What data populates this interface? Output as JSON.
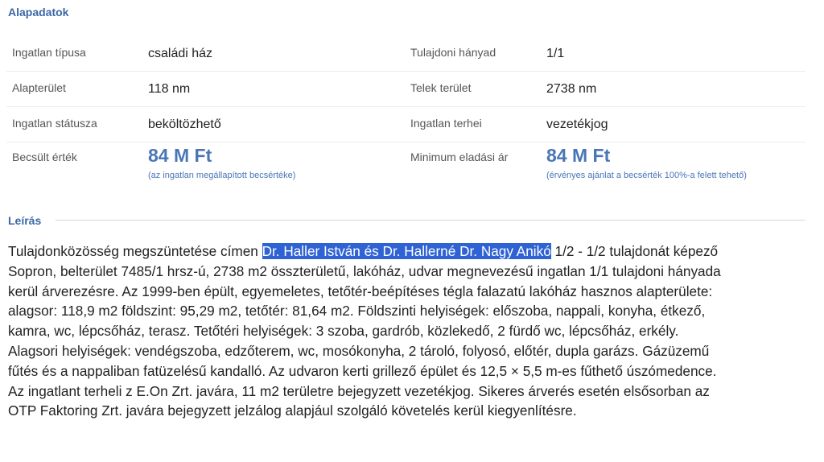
{
  "basic_data": {
    "title": "Alapadatok",
    "rows": [
      {
        "left": {
          "label": "Ingatlan típusa",
          "value": "családi ház"
        },
        "right": {
          "label": "Tulajdoni hányad",
          "value": "1/1"
        }
      },
      {
        "left": {
          "label": "Alapterület",
          "value": "118 nm"
        },
        "right": {
          "label": "Telek terület",
          "value": "2738 nm"
        }
      },
      {
        "left": {
          "label": "Ingatlan státusza",
          "value": "beköltözhető"
        },
        "right": {
          "label": "Ingatlan terhei",
          "value": "vezetékjog"
        }
      },
      {
        "left": {
          "label": "Becsült érték",
          "value": "84 M Ft",
          "note": "(az ingatlan megállapított becsértéke)"
        },
        "right": {
          "label": "Minimum eladási ár",
          "value": "84 M Ft",
          "note": "(érvényes ajánlat a becsérték 100%-a felett tehető)"
        }
      }
    ]
  },
  "description": {
    "title": "Leírás",
    "line1_before": "Tulajdonközösség megszüntetése címen ",
    "line1_highlight": "Dr. Haller István és Dr. Hallerné Dr. Nagy Anikó",
    "line1_after": " 1/2 - 1/2 tulajdonát képező",
    "lines": [
      "Sopron, belterület 7485/1 hrsz-ú, 2738 m2 összterületű, lakóház, udvar megnevezésű ingatlan 1/1 tulajdoni hányada",
      "kerül árverezésre. Az 1999-ben épült, egyemeletes, tetőtér-beépítéses tégla falazatú lakóház hasznos alapterülete:",
      "alagsor: 118,9 m2 földszint: 95,29 m2, tetőtér: 81,64 m2. Földszinti helyiségek: előszoba, nappali, konyha, étkező,",
      "kamra, wc, lépcsőház, terasz. Tetőtéri helyiségek: 3 szoba, gardrób, közlekedő, 2 fürdő wc, lépcsőház, erkély.",
      "Alagsori helyiségek: vendégszoba, edzőterem, wc, mosókonyha, 2 tároló, folyosó, előtér, dupla garázs. Gázüzemű",
      "fűtés és a nappaliban fatüzelésű kandalló. Az udvaron kerti grillező épület és 12,5 × 5,5 m-es fűthető úszómedence.",
      "Az ingatlant terheli z E.On Zrt. javára, 11 m2 területre bejegyzett vezetékjog. Sikeres árverés esetén elsősorban az",
      "OTP Faktoring Zrt. javára bejegyzett jelzálog alapjául szolgáló követelés kerül kiegyenlítésre."
    ]
  },
  "colors": {
    "accent": "#3b67a6",
    "value_blue": "#4a76b6",
    "selection": "#2f63d4"
  }
}
